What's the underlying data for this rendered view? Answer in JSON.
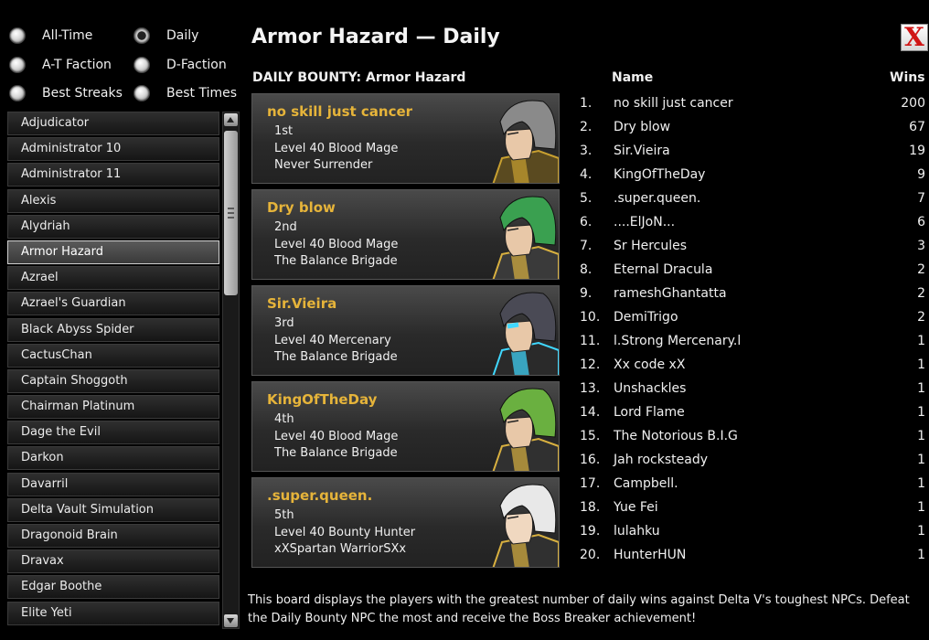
{
  "filters": [
    {
      "label": "All-Time",
      "selected": false
    },
    {
      "label": "Daily",
      "selected": true
    },
    {
      "label": "A-T Faction",
      "selected": false
    },
    {
      "label": "D-Faction",
      "selected": false
    },
    {
      "label": "Best Streaks",
      "selected": false
    },
    {
      "label": "Best Times",
      "selected": false
    }
  ],
  "npc_list": {
    "selected": "Armor Hazard",
    "items": [
      "Adjudicator",
      "Administrator 10",
      "Administrator 11",
      "Alexis",
      "Alydriah",
      "Armor Hazard",
      "Azrael",
      "Azrael's Guardian",
      "Black Abyss Spider",
      "CactusChan",
      "Captain Shoggoth",
      "Chairman Platinum",
      "Dage the Evil",
      "Darkon",
      "Davarril",
      "Delta Vault Simulation",
      "Dragonoid Brain",
      "Dravax",
      "Edgar Boothe",
      "Elite Yeti"
    ]
  },
  "title": "Armor Hazard — Daily",
  "close_label": "X",
  "bounty_heading": "DAILY BOUNTY: Armor Hazard",
  "top_players": [
    {
      "name": "no skill just cancer",
      "place": "1st",
      "level_class": "Level 40 Blood Mage",
      "faction": "Never Surrender",
      "portrait": "gray-hair-warrior-portrait"
    },
    {
      "name": "Dry blow",
      "place": "2nd",
      "level_class": "Level 40 Blood Mage",
      "faction": "The Balance Brigade",
      "portrait": "green-hair-mage-portrait"
    },
    {
      "name": "Sir.Vieira",
      "place": "3rd",
      "level_class": "Level 40 Mercenary",
      "faction": "The Balance Brigade",
      "portrait": "cyborg-visor-portrait"
    },
    {
      "name": "KingOfTheDay",
      "place": "4th",
      "level_class": "Level 40 Blood Mage",
      "faction": "The Balance Brigade",
      "portrait": "green-helmet-portrait"
    },
    {
      "name": ".super.queen.",
      "place": "5th",
      "level_class": "Level 40 Bounty Hunter",
      "faction": "xXSpartan WarriorSXx",
      "portrait": "white-hair-queen-portrait"
    }
  ],
  "leaderboard": {
    "name_header": "Name",
    "wins_header": "Wins",
    "rows": [
      {
        "rank": "1.",
        "name": "no skill just cancer",
        "wins": "200"
      },
      {
        "rank": "2.",
        "name": "Dry blow",
        "wins": "67"
      },
      {
        "rank": "3.",
        "name": "Sir.Vieira",
        "wins": "19"
      },
      {
        "rank": "4.",
        "name": "KingOfTheDay",
        "wins": "9"
      },
      {
        "rank": "5.",
        "name": ".super.queen.",
        "wins": "7"
      },
      {
        "rank": "6.",
        "name": "....ElJoN...",
        "wins": "6"
      },
      {
        "rank": "7.",
        "name": "Sr Hercules",
        "wins": "3"
      },
      {
        "rank": "8.",
        "name": "Eternal Dracula",
        "wins": "2"
      },
      {
        "rank": "9.",
        "name": "rameshGhantatta",
        "wins": "2"
      },
      {
        "rank": "10.",
        "name": "DemiTrigo",
        "wins": "2"
      },
      {
        "rank": "11.",
        "name": "l.Strong Mercenary.l",
        "wins": "1"
      },
      {
        "rank": "12.",
        "name": "Xx code xX",
        "wins": "1"
      },
      {
        "rank": "13.",
        "name": "Unshackles",
        "wins": "1"
      },
      {
        "rank": "14.",
        "name": "Lord Flame",
        "wins": "1"
      },
      {
        "rank": "15.",
        "name": "The Notorious B.I.G",
        "wins": "1"
      },
      {
        "rank": "16.",
        "name": "Jah rocksteady",
        "wins": "1"
      },
      {
        "rank": "17.",
        "name": "Campbell.",
        "wins": "1"
      },
      {
        "rank": "18.",
        "name": "Yue Fei",
        "wins": "1"
      },
      {
        "rank": "19.",
        "name": "lulahku",
        "wins": "1"
      },
      {
        "rank": "20.",
        "name": "HunterHUN",
        "wins": "1"
      }
    ]
  },
  "footer_text": "This board displays the players with the greatest number of daily wins against Delta V's toughest NPCs. Defeat the Daily Bounty NPC the most and receive the Boss Breaker achievement!",
  "colors": {
    "name_gold": "#e6b43a",
    "close_red": "#d01515",
    "background": "#000000"
  }
}
